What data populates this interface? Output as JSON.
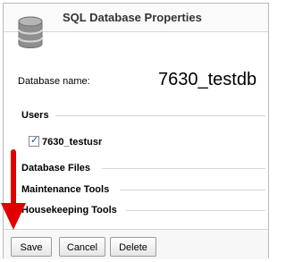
{
  "window": {
    "title": "SQL Database Properties"
  },
  "form": {
    "db_name_label": "Database name:",
    "db_name_value": "7630_testdb"
  },
  "sections": {
    "users": "Users",
    "database_files": "Database Files",
    "maintenance_tools": "Maintenance Tools",
    "housekeeping_tools": "Housekeeping Tools"
  },
  "users": [
    {
      "name": "7630_testusr",
      "checked": true
    }
  ],
  "buttons": {
    "save": "Save",
    "cancel": "Cancel",
    "delete": "Delete"
  },
  "colors": {
    "annotation_arrow": "#e00000",
    "icon_gray": "#7a7a7a"
  }
}
